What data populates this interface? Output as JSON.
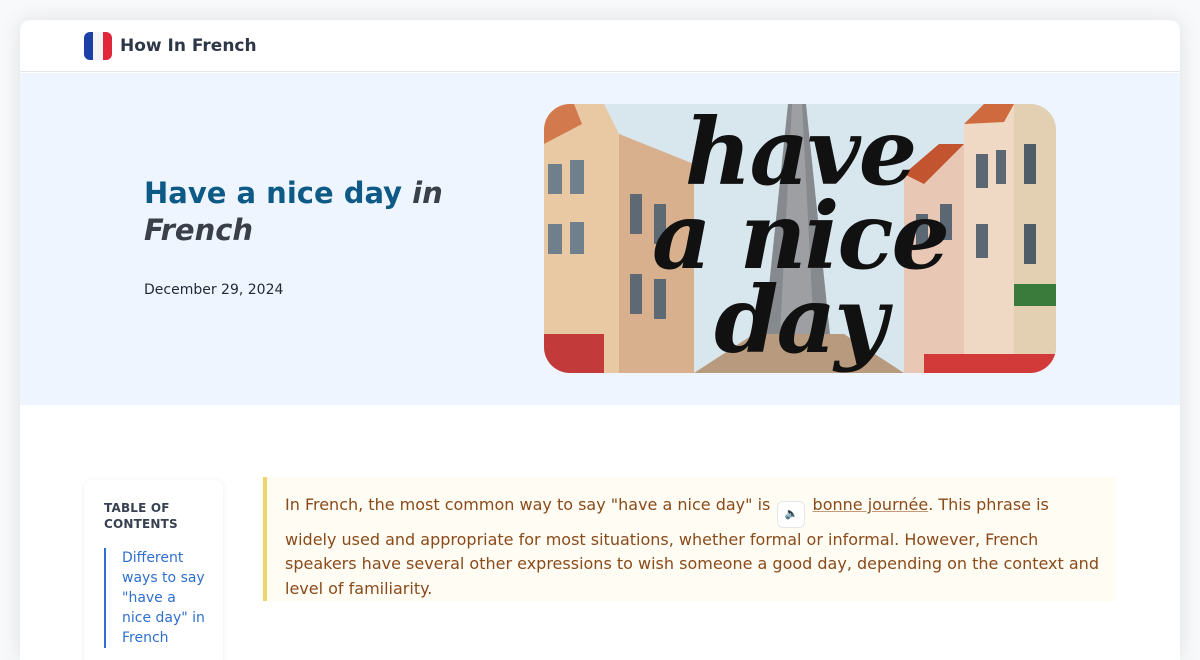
{
  "header": {
    "brand": "How In French",
    "logo_icon": "french-flag-icon"
  },
  "hero": {
    "title_main": "Have a nice day",
    "title_italic_1": "in",
    "title_italic_2": "French",
    "date": "December 29, 2024",
    "image_text": {
      "line1": "have",
      "line2": "a nice",
      "line3": "day"
    }
  },
  "toc": {
    "heading": "TABLE OF CONTENTS",
    "items": [
      {
        "label": "Different ways to say \"have a nice day\" in French"
      }
    ]
  },
  "callout": {
    "before": "In French, the most common way to say \"have a nice day\" is",
    "audio_icon": "speaker-icon",
    "phrase": "bonne journée",
    "after": ". This phrase is widely used and appropriate for most situations, whether formal or informal. However, French speakers have several other expressions to wish someone a good day, depending on the context and level of familiarity."
  },
  "colors": {
    "brand_blue": "#0e5a86",
    "hero_bg": "#eef5ff",
    "callout_bg": "#fffcf4",
    "callout_border": "#f1d36b",
    "callout_text": "#8a4a19",
    "toc_accent": "#2f6fcf"
  }
}
